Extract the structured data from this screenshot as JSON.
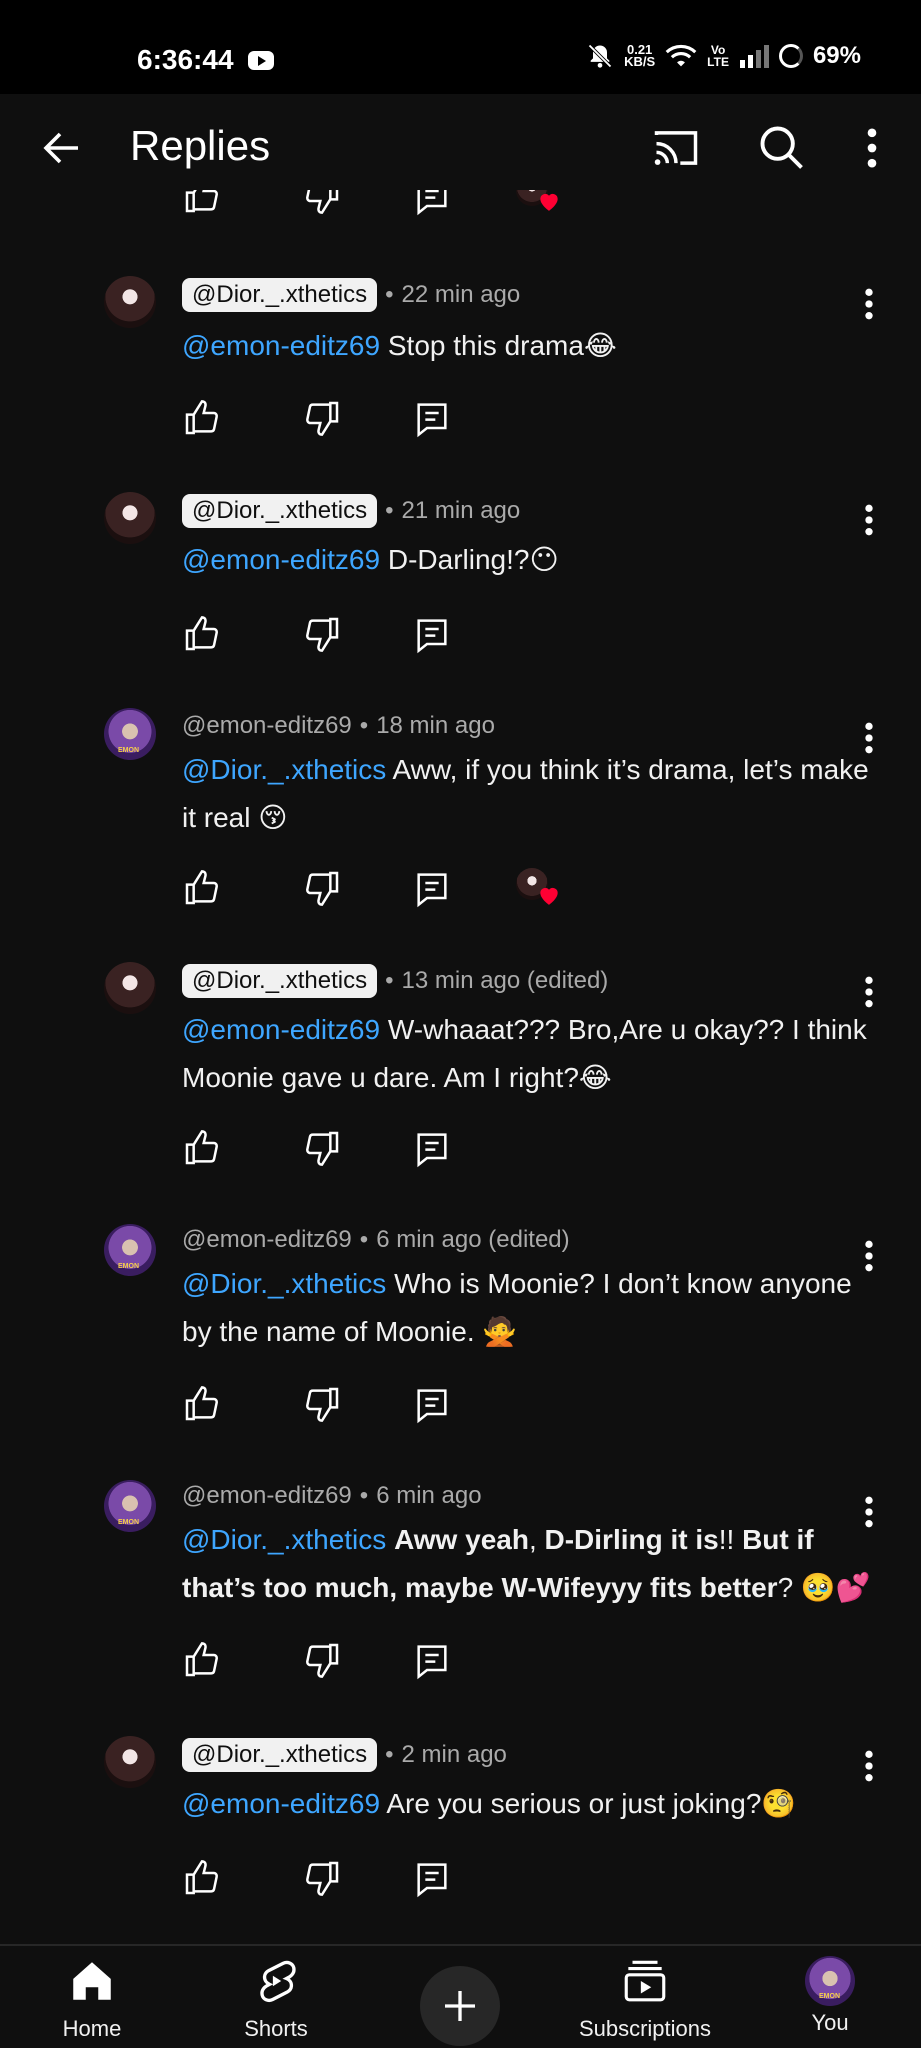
{
  "status_bar": {
    "time": "6:36:44",
    "net_speed_top": "0.21",
    "net_speed_bottom": "KB/S",
    "volte_top": "Vo",
    "volte_bottom": "LTE",
    "battery": "69%"
  },
  "header": {
    "title": "Replies",
    "icons": [
      "back-arrow-icon",
      "cast-icon",
      "search-icon",
      "more-vert-icon"
    ]
  },
  "comments": [
    {
      "handle": "@Dior._.xthetics",
      "handle_style": "chip",
      "time": "22 min ago",
      "mention": "@emon-editz69",
      "text": "Stop this drama😂",
      "hearted": false,
      "avatar": "dior"
    },
    {
      "handle": "@Dior._.xthetics",
      "handle_style": "chip",
      "time": "21 min ago",
      "mention": "@emon-editz69",
      "text": "D-Darling!?😶",
      "hearted": false,
      "avatar": "dior"
    },
    {
      "handle": "@emon-editz69",
      "handle_style": "plain",
      "time": "18 min ago",
      "mention": "@Dior._.xthetics",
      "text": "Aww, if you think it’s drama, let’s make it real 😚",
      "hearted": true,
      "avatar": "emon"
    },
    {
      "handle": "@Dior._.xthetics",
      "handle_style": "chip",
      "time": "13 min ago (edited)",
      "mention": "@emon-editz69",
      "text": "W-whaaat??? Bro,Are u okay?? I think Moonie gave u dare. Am I right?😂",
      "hearted": false,
      "avatar": "dior"
    },
    {
      "handle": "@emon-editz69",
      "handle_style": "plain",
      "time": "6 min ago (edited)",
      "mention": "@Dior._.xthetics",
      "text": " Who is Moonie? I don’t know anyone by the name of Moonie. 🙅",
      "hearted": false,
      "avatar": "emon"
    },
    {
      "handle": "@emon-editz69",
      "handle_style": "plain",
      "time": "6 min ago",
      "mention": "@Dior._.xthetics",
      "text_parts": [
        {
          "t": " ",
          "b": false
        },
        {
          "t": "Aww yeah",
          "b": true
        },
        {
          "t": ", ",
          "b": false
        },
        {
          "t": "D-Dirling it is",
          "b": true
        },
        {
          "t": "!! ",
          "b": false
        },
        {
          "t": "But if that’s too much, maybe W-Wifeyyy fits better",
          "b": true
        },
        {
          "t": "? 🥹💕",
          "b": false
        }
      ],
      "hearted": false,
      "avatar": "emon"
    },
    {
      "handle": "@Dior._.xthetics",
      "handle_style": "chip",
      "time": "2 min ago",
      "mention": "@emon-editz69",
      "text": "Are you serious or just joking?🧐",
      "hearted": false,
      "avatar": "dior"
    }
  ],
  "bottom_nav": {
    "home": "Home",
    "shorts": "Shorts",
    "subscriptions": "Subscriptions",
    "you": "You"
  },
  "colors": {
    "background": "#0f0f0f",
    "mention": "#3ea6ff",
    "meta": "#aaaaaa",
    "heart": "#ff0033"
  }
}
